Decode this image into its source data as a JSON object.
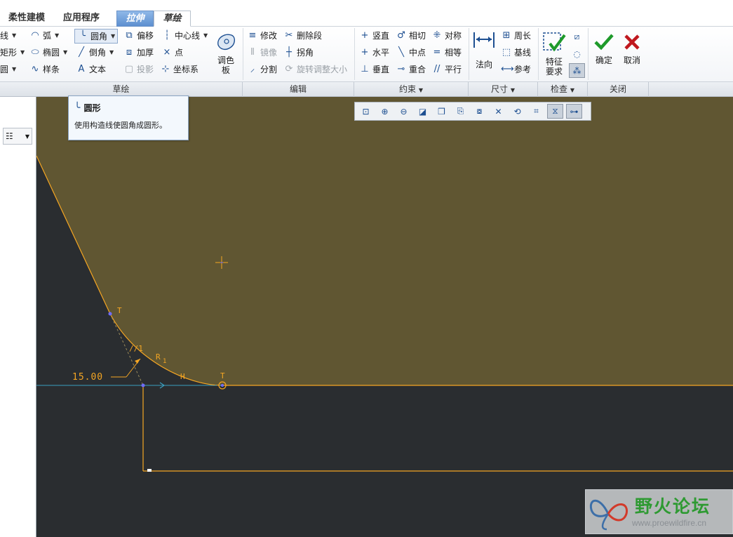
{
  "tabs": {
    "flex_modeling": "柔性建模",
    "applications": "应用程序",
    "extrude": "拉伸",
    "sketch": "草绘"
  },
  "sketch_group": {
    "line_partial": "线",
    "arc": "弧",
    "fillet": "圆角",
    "offset": "偏移",
    "centerline": "中心线",
    "rectangle_partial": "矩形",
    "ellipse": "椭圆",
    "chamfer": "倒角",
    "thicken": "加厚",
    "point": "点",
    "circle_partial": "圆",
    "spline": "样条",
    "text": "文本",
    "project": "投影",
    "coordinate_system": "坐标系",
    "palette_line1": "调色",
    "palette_line2": "板",
    "group_title": "草绘"
  },
  "edit_group": {
    "modify": "修改",
    "delete_segment": "删除段",
    "mirror": "镜像",
    "corner": "拐角",
    "divide": "分割",
    "rotate_resize": "旋转调整大小",
    "group_title": "编辑"
  },
  "constrain_group": {
    "vertical": "竖直",
    "tangent": "相切",
    "symmetric": "对称",
    "horizontal": "水平",
    "midpoint": "中点",
    "equal": "相等",
    "perpendicular": "垂直",
    "coincident": "重合",
    "parallel": "平行",
    "group_title": "约束"
  },
  "dimension_group": {
    "normal": "法向",
    "perimeter": "周长",
    "baseline": "基线",
    "reference": "参考",
    "group_title": "尺寸"
  },
  "inspect_group": {
    "feature_req_line1": "特征",
    "feature_req_line2": "要求",
    "group_title": "检查"
  },
  "close_group": {
    "ok": "确定",
    "cancel": "取消",
    "group_title": "关闭"
  },
  "tooltip": {
    "title": "圆形",
    "description": "使用构造线使圆角成圆形。"
  },
  "sketch": {
    "dimension_value": "15.00",
    "label_t1": "T",
    "label_t2": "T",
    "label_parallel": "//1",
    "label_r1": "R",
    "label_r1_sub": "1",
    "label_h": "H"
  },
  "watermark": {
    "name": "野火论坛",
    "url": "www.proewildfire.cn"
  },
  "colors": {
    "sketch_background": "#605632",
    "solid_region": "#2a2d30",
    "sketch_entity": "#f5a623",
    "construction": "#3a9fbf",
    "selected_point": "#6f6cff"
  }
}
